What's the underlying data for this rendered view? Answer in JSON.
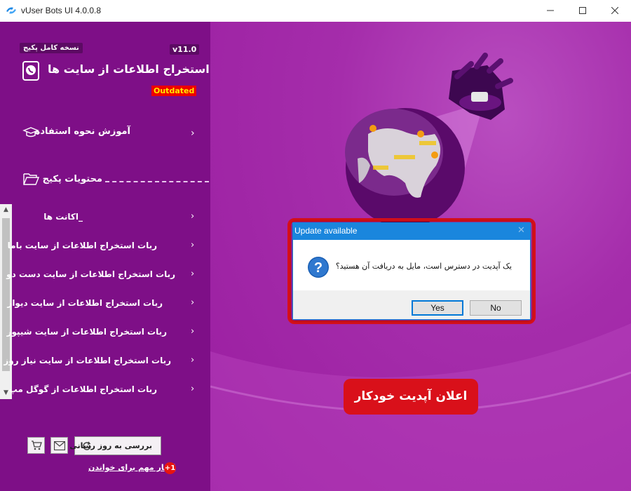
{
  "window": {
    "title": "vUser Bots UI 4.0.0.8",
    "controls": [
      "minimize-icon",
      "maximize-icon",
      "close-icon"
    ]
  },
  "sidebar": {
    "badge": "نسخه کامل پکیج",
    "version": "v11.0",
    "title": "استخراج اطلاعات از سایت ها",
    "status": "Outdated",
    "tutorial": {
      "label": "آموزش نحوه استفاده",
      "icon": "graduation-cap-icon"
    },
    "package_heading": {
      "label": "محتویات پکیج",
      "icon": "folder-open-icon"
    },
    "items": [
      {
        "label": "_اکانت ها"
      },
      {
        "label": "ربات استخراج اطلاعات از سایت باما"
      },
      {
        "label": "ربات استخراج اطلاعات از سایت دست دو"
      },
      {
        "label": "ربات استخراج اطلاعات از سایت دیوار"
      },
      {
        "label": "ربات استخراج اطلاعات از سایت شیپور"
      },
      {
        "label": "ربات استخراج اطلاعات از سایت نیاز روز"
      },
      {
        "label": "ربات استخراج اطلاعات از گوگل مپ"
      }
    ],
    "footer": {
      "update_button": "بررسی به روز رسانی",
      "news_link": "اخبار مهم برای خواندن",
      "news_count": "+1"
    }
  },
  "dialog": {
    "title": "Update available",
    "message": "یک آپدیت در دسترس است، مایل به دریافت آن هستید؟",
    "yes": "Yes",
    "no": "No"
  },
  "notice": "اعلان آپدیت خودکار",
  "colors": {
    "sidebar": "#7e0f87",
    "background": "#a222a8",
    "accent_red": "#d9101a",
    "dialog_title": "#1a86dd"
  }
}
